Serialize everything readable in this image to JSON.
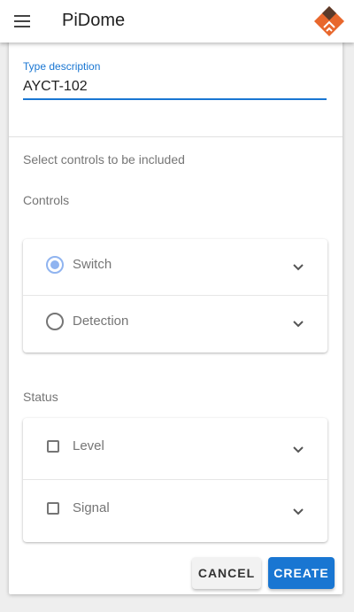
{
  "app": {
    "title": "PiDome",
    "brand_color": "#e8672c"
  },
  "form": {
    "type_description_label": "Type description",
    "type_description_value": "AYCT-102",
    "helper_text": "Select controls to be included"
  },
  "controls": {
    "label": "Controls",
    "items": [
      {
        "label": "Switch",
        "selected": true
      },
      {
        "label": "Detection",
        "selected": false
      }
    ]
  },
  "status": {
    "label": "Status",
    "items": [
      {
        "label": "Level",
        "checked": false
      },
      {
        "label": "Signal",
        "checked": false
      }
    ]
  },
  "actions": {
    "cancel_label": "CANCEL",
    "create_label": "CREATE"
  },
  "colors": {
    "accent": "#1976d2",
    "radio_selected": "#90b4f0"
  }
}
